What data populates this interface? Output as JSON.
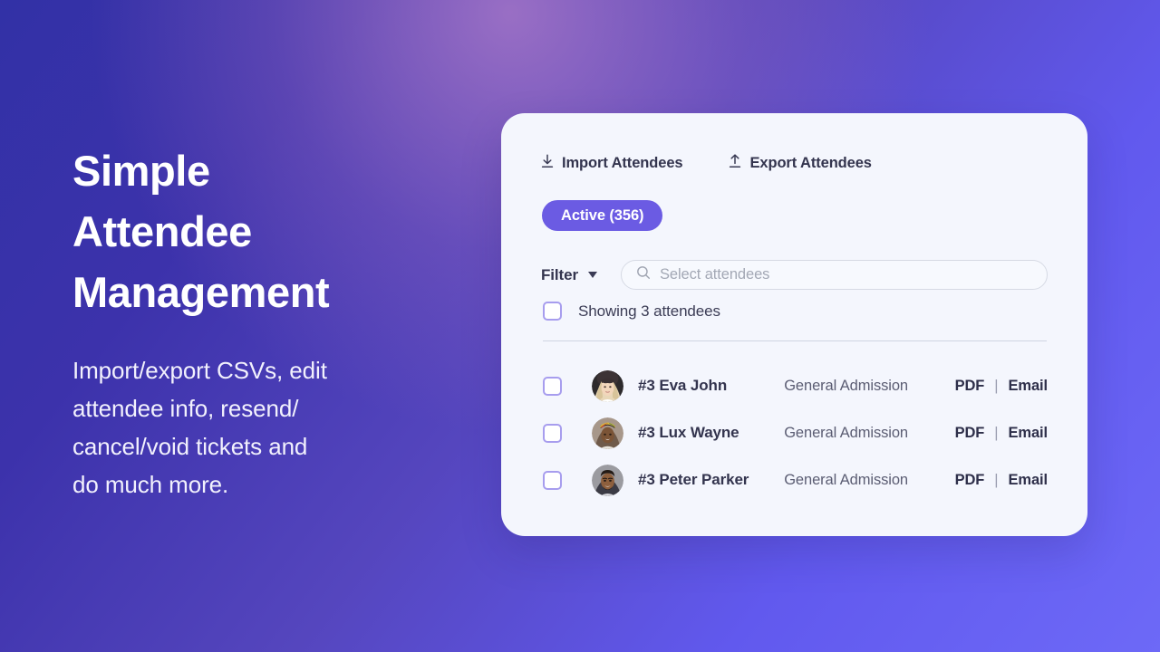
{
  "hero": {
    "title_lines": [
      "Simple",
      "Attendee",
      "Management"
    ],
    "subtitle_lines": [
      "Import/export CSVs, edit",
      "attendee info, resend/",
      "cancel/void tickets and",
      "do much more."
    ]
  },
  "colors": {
    "bg_start": "#3231a6",
    "bg_end": "#6d69f7",
    "bg_highlight": "#a878c8",
    "card_bg": "#f4f6fd",
    "accent": "#6b5be3",
    "checkbox_border": "#a79dee",
    "text_dark": "#33344e",
    "text_muted": "#5b5d73",
    "divider": "#cfd5e2"
  },
  "card": {
    "toolbar": {
      "import_label": "Import Attendees",
      "import_icon": "download-icon",
      "export_label": "Export Attendees",
      "export_icon": "upload-icon"
    },
    "status_badge": {
      "label": "Active (356)"
    },
    "filter": {
      "label": "Filter",
      "caret_icon": "chevron-down-icon"
    },
    "search": {
      "icon": "search-icon",
      "placeholder": "Select attendees",
      "value": ""
    },
    "showing": {
      "label": "Showing 3 attendees",
      "checked": false
    },
    "actions": {
      "pdf_label": "PDF",
      "separator": "|",
      "email_label": "Email"
    },
    "attendees": [
      {
        "checked": false,
        "avatar": "avatar-eva-john",
        "name": "#3 Eva John",
        "ticket": "General Admission"
      },
      {
        "checked": false,
        "avatar": "avatar-lux-wayne",
        "name": "#3 Lux Wayne",
        "ticket": "General Admission"
      },
      {
        "checked": false,
        "avatar": "avatar-peter-parker",
        "name": "#3 Peter Parker",
        "ticket": "General Admission"
      }
    ]
  }
}
